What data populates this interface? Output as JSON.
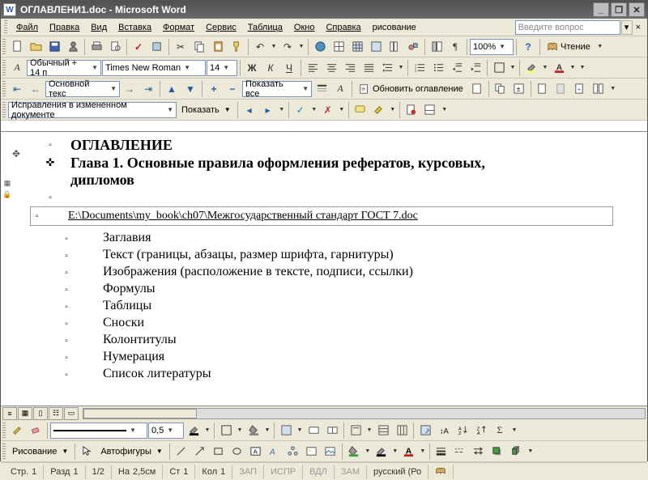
{
  "window": {
    "title": "ОГЛАВЛЕНИ1.doc - Microsoft Word"
  },
  "menu": {
    "file": "Файл",
    "edit": "Правка",
    "view": "Вид",
    "insert": "Вставка",
    "format": "Формат",
    "tools": "Сервис",
    "table": "Таблица",
    "window": "Окно",
    "help": "Справка",
    "drawing": "рисование"
  },
  "help_box": {
    "placeholder": "Введите вопрос"
  },
  "toolbar1": {
    "zoom": "100%",
    "reading": "Чтение"
  },
  "toolbar2": {
    "style": "Обычный + 14 п",
    "font": "Times New Roman",
    "size": "14",
    "bold": "Ж",
    "italic": "К",
    "underline": "Ч"
  },
  "toolbar3": {
    "style_combo": "Основной текс",
    "show_all": "Показать все",
    "update_toc": "Обновить оглавление"
  },
  "toolbar4": {
    "track_combo": "Исправления в измененном документе",
    "show": "Показать"
  },
  "document": {
    "title": "ОГЛАВЛЕНИЕ",
    "chapter": "Глава 1. Основные правила оформления рефератов, курсовых, дипломов",
    "link": "E:\\Documents\\my_book\\ch07\\Межгосударственный стандарт ГОСТ 7.doc",
    "items": [
      "Заглавия",
      "Текст (границы, абзацы, размер шрифта, гарнитуры)",
      "Изображения (расположение в тексте, подписи, ссылки)",
      "Формулы",
      "Таблицы",
      "Сноски",
      "Колонтитулы",
      "Нумерация",
      "Список литературы"
    ]
  },
  "toolbar5": {
    "width": "0,5"
  },
  "toolbar6": {
    "draw": "Рисование",
    "autoshapes": "Автофигуры"
  },
  "status": {
    "page_lbl": "Стр.",
    "page": "1",
    "sect_lbl": "Разд",
    "sect": "1",
    "pages": "1/2",
    "at_lbl": "На",
    "at": "2,5см",
    "line_lbl": "Ст",
    "line": "1",
    "col_lbl": "Кол",
    "col": "1",
    "rec": "ЗАП",
    "trk": "ИСПР",
    "ext": "ВДЛ",
    "ovr": "ЗАМ",
    "lang": "русский (Ро"
  }
}
